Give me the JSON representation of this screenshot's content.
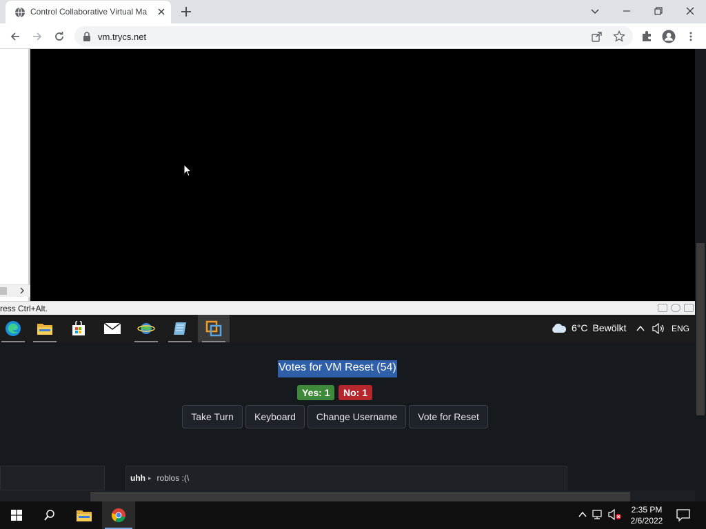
{
  "browser": {
    "tab_title": "Control Collaborative Virtual Ma",
    "url": "vm.trycs.net"
  },
  "vm": {
    "status_text": "ress Ctrl+Alt.",
    "weather": {
      "temp": "6°C",
      "condition": "Bewölkt"
    },
    "language": "ENG",
    "taskbar_icons": [
      "edge-icon",
      "file-explorer-icon",
      "store-icon",
      "mail-icon",
      "network-globe-icon",
      "notepad-icon",
      "vmware-icon"
    ]
  },
  "reset_vote": {
    "title": "Votes for VM Reset (54)",
    "yes_label": "Yes: 1",
    "no_label": "No: 1"
  },
  "controls": {
    "take_turn": "Take Turn",
    "keyboard": "Keyboard",
    "change_username": "Change Username",
    "vote_reset": "Vote for Reset"
  },
  "chat": {
    "messages": [
      {
        "user": "uhh",
        "text": "roblos :(\\"
      }
    ]
  },
  "host": {
    "time": "2:35 PM",
    "date": "2/6/2022"
  },
  "colors": {
    "yes": "#3f8a3a",
    "no": "#b3272d",
    "highlight": "#2f5fa8"
  }
}
